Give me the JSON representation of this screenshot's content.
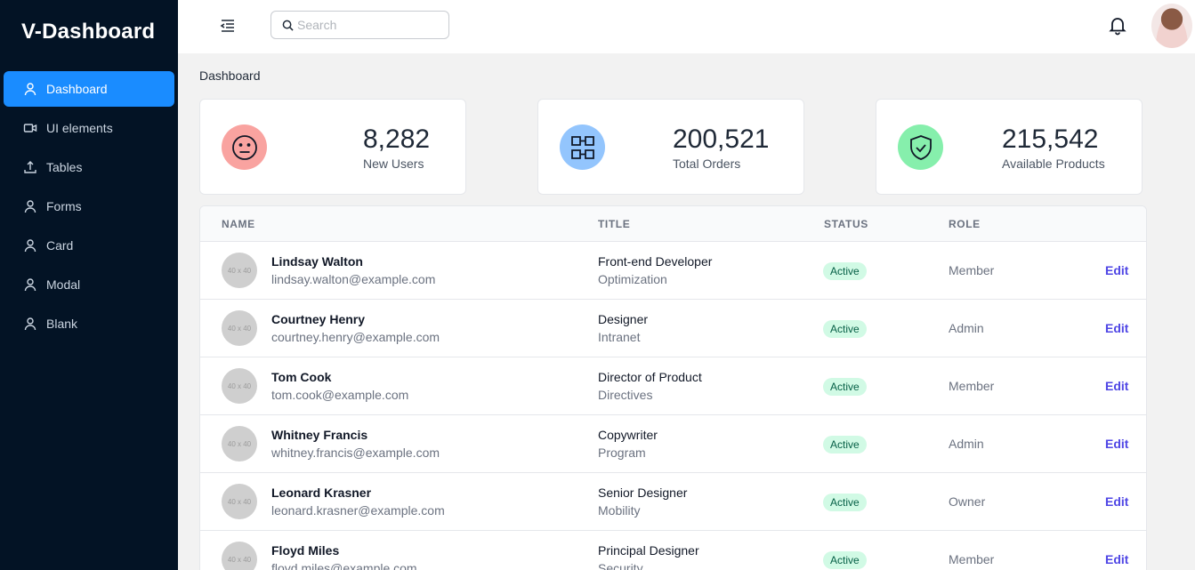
{
  "brand": "V-Dashboard",
  "sidebar": {
    "items": [
      {
        "label": "Dashboard",
        "icon": "user-icon",
        "active": true
      },
      {
        "label": "UI elements",
        "icon": "video-icon",
        "active": false
      },
      {
        "label": "Tables",
        "icon": "upload-icon",
        "active": false
      },
      {
        "label": "Forms",
        "icon": "user-icon",
        "active": false
      },
      {
        "label": "Card",
        "icon": "user-icon",
        "active": false
      },
      {
        "label": "Modal",
        "icon": "user-icon",
        "active": false
      },
      {
        "label": "Blank",
        "icon": "user-icon",
        "active": false
      }
    ]
  },
  "header": {
    "menu_icon": "menu-collapse-icon",
    "search": {
      "placeholder": "Search",
      "value": ""
    },
    "notification_icon": "bell-icon"
  },
  "breadcrumb": "Dashboard",
  "stats": [
    {
      "value": "8,282",
      "label": "New Users",
      "icon": "emoji-neutral-icon",
      "color": "#f9a3a0"
    },
    {
      "value": "200,521",
      "label": "Total Orders",
      "icon": "orders-grid-icon",
      "color": "#93c5fd"
    },
    {
      "value": "215,542",
      "label": "Available Products",
      "icon": "shield-check-icon",
      "color": "#86efac"
    }
  ],
  "table": {
    "headers": {
      "name": "NAME",
      "title": "TITLE",
      "status": "STATUS",
      "role": "ROLE"
    },
    "rows": [
      {
        "avatar": "40 x 40",
        "name": "Lindsay Walton",
        "email": "lindsay.walton@example.com",
        "title": "Front-end Developer",
        "department": "Optimization",
        "status": "Active",
        "role": "Member",
        "action": "Edit"
      },
      {
        "avatar": "40 x 40",
        "name": "Courtney Henry",
        "email": "courtney.henry@example.com",
        "title": "Designer",
        "department": "Intranet",
        "status": "Active",
        "role": "Admin",
        "action": "Edit"
      },
      {
        "avatar": "40 x 40",
        "name": "Tom Cook",
        "email": "tom.cook@example.com",
        "title": "Director of Product",
        "department": "Directives",
        "status": "Active",
        "role": "Member",
        "action": "Edit"
      },
      {
        "avatar": "40 x 40",
        "name": "Whitney Francis",
        "email": "whitney.francis@example.com",
        "title": "Copywriter",
        "department": "Program",
        "status": "Active",
        "role": "Admin",
        "action": "Edit"
      },
      {
        "avatar": "40 x 40",
        "name": "Leonard Krasner",
        "email": "leonard.krasner@example.com",
        "title": "Senior Designer",
        "department": "Mobility",
        "status": "Active",
        "role": "Owner",
        "action": "Edit"
      },
      {
        "avatar": "40 x 40",
        "name": "Floyd Miles",
        "email": "floyd.miles@example.com",
        "title": "Principal Designer",
        "department": "Security",
        "status": "Active",
        "role": "Member",
        "action": "Edit"
      }
    ]
  }
}
